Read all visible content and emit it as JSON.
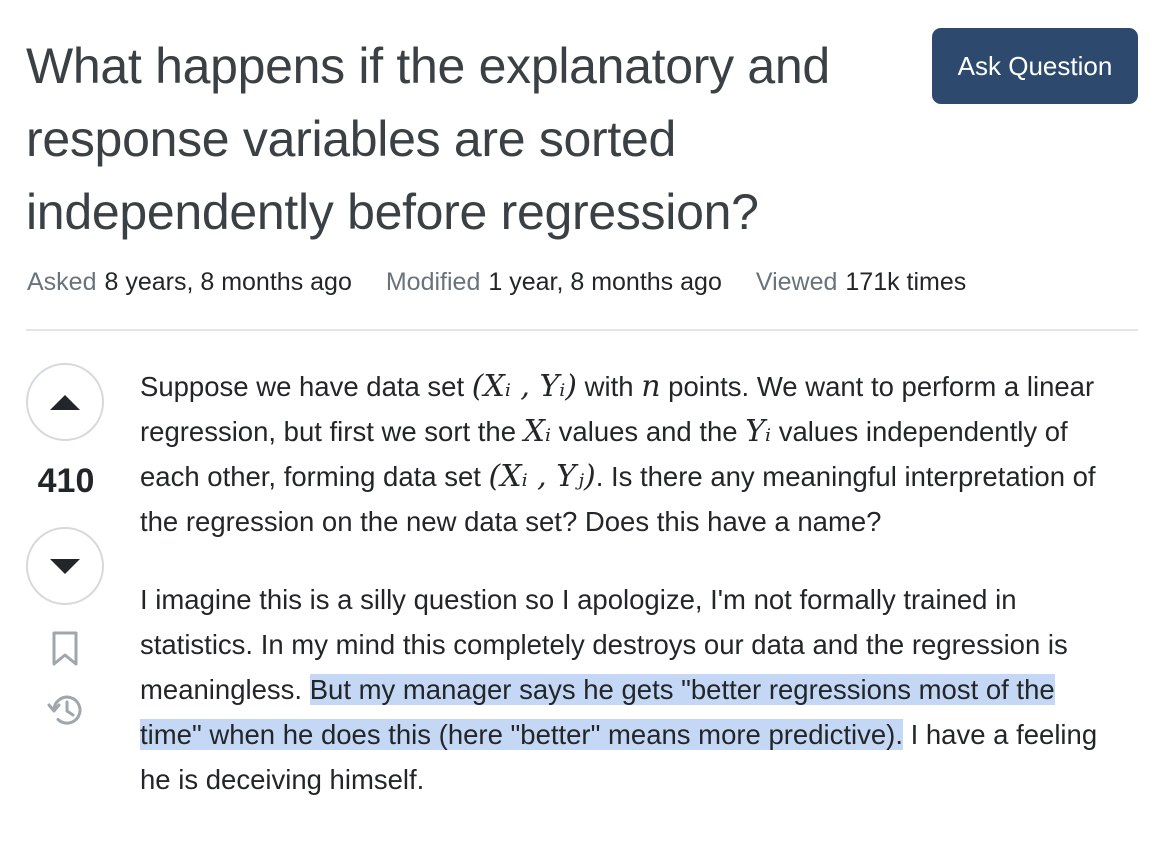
{
  "question": {
    "title": "What happens if the explanatory and response variables are sorted independently before regression?",
    "ask_button_label": "Ask Question"
  },
  "meta": {
    "asked_label": "Asked",
    "asked_value": "8 years, 8 months ago",
    "modified_label": "Modified",
    "modified_value": "1 year, 8 months ago",
    "viewed_label": "Viewed",
    "viewed_value": "171k times"
  },
  "votes": {
    "count": "410"
  },
  "body": {
    "p1": {
      "t1": "Suppose we have data set ",
      "m1": "(Xᵢ , Yᵢ)",
      "t2": " with ",
      "m2": "n",
      "t3": " points. We want to perform a linear regression, but first we sort the ",
      "m3": "Xᵢ",
      "t4": " values and the ",
      "m4": "Yᵢ",
      "t5": " values independently of each other, forming data set ",
      "m5": "(Xᵢ , Yⱼ)",
      "t6": ". Is there any meaningful interpretation of the regression on the new data set? Does this have a name?"
    },
    "p2": {
      "t1": "I imagine this is a silly question so I apologize, I'm not formally trained in statistics. In my mind this completely destroys our data and the regression is meaningless. ",
      "highlight": "But my manager says he gets \"better regressions most of the time\" when he does this (here \"better\" means more predictive).",
      "t2": " I have a feeling he is deceiving himself."
    }
  },
  "icons": {
    "upvote": "arrow-up-icon",
    "downvote": "arrow-down-icon",
    "bookmark": "bookmark-icon",
    "history": "history-icon"
  },
  "colors": {
    "ask_button_bg": "#2d4a6e",
    "highlight": "#c4d8f5",
    "meta_label": "#6a737c"
  }
}
